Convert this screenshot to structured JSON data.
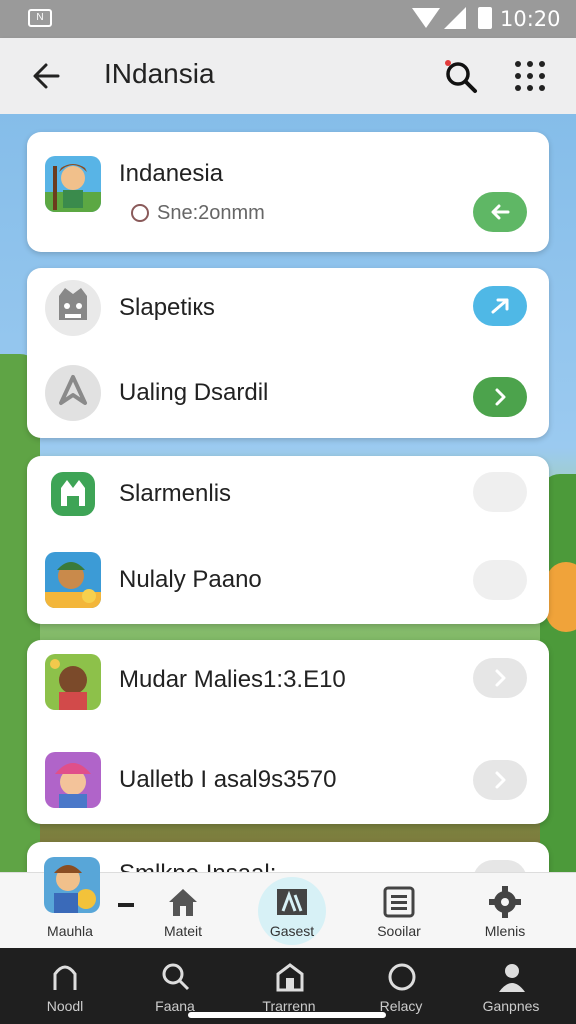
{
  "status_bar": {
    "sim_label": "N",
    "time": "10:20"
  },
  "app_bar": {
    "title": "INdansia"
  },
  "cards": [
    {
      "rows": [
        {
          "label": "Indanesia",
          "sub": "Sne:2onmm",
          "action": {
            "color": "#5fb765",
            "icon": "arrow-left-icon"
          }
        }
      ]
    },
    {
      "rows": [
        {
          "label": "Slapetiкs",
          "action": {
            "color": "#4fb8e6",
            "icon": "arrow-icon"
          }
        },
        {
          "label": "Ualing Dsardil",
          "action": {
            "color": "#4ca34c",
            "icon": "chevron-right-icon"
          }
        }
      ]
    },
    {
      "rows": [
        {
          "label": "Slarmenlis",
          "action": {
            "color": "#efefef",
            "icon": ""
          }
        },
        {
          "label": "Nulaly Paano",
          "action": {
            "color": "#efefef",
            "icon": ""
          }
        }
      ]
    },
    {
      "rows": [
        {
          "label": "Mudar Malies1:3.E10",
          "action": {
            "color": "#e6e6e6",
            "icon": "chevron-right-icon"
          }
        },
        {
          "label": "Ualletb I asal9s3570",
          "action": {
            "color": "#e6e6e6",
            "icon": "chevron-right-icon"
          }
        }
      ]
    },
    {
      "rows": [
        {
          "label": "Smlkne Insaal:",
          "action": {
            "color": "#e6e6e6",
            "icon": ""
          }
        }
      ]
    }
  ],
  "app_nav": {
    "items": [
      {
        "label": "Mauhla",
        "icon": "avatar-icon"
      },
      {
        "label": "",
        "icon": "dash-icon"
      },
      {
        "label": "Mateit",
        "icon": "home-icon"
      },
      {
        "label": "Gasest",
        "icon": "grid-icon"
      },
      {
        "label": "Sooilar",
        "icon": "list-icon"
      },
      {
        "label": "Mlenis",
        "icon": "gear-icon"
      }
    ]
  },
  "sys_nav": {
    "items": [
      {
        "label": "Noodl",
        "icon": "arch-icon"
      },
      {
        "label": "Faana",
        "icon": "search-icon"
      },
      {
        "label": "Trarrenn",
        "icon": "house-icon"
      },
      {
        "label": "Relacy",
        "icon": "circle-icon"
      },
      {
        "label": "Ganpnes",
        "icon": "person-icon"
      }
    ]
  },
  "colors": {
    "accent_green": "#5fb765",
    "accent_blue": "#4fb8e6",
    "status_bar": "#9a9a9a"
  }
}
